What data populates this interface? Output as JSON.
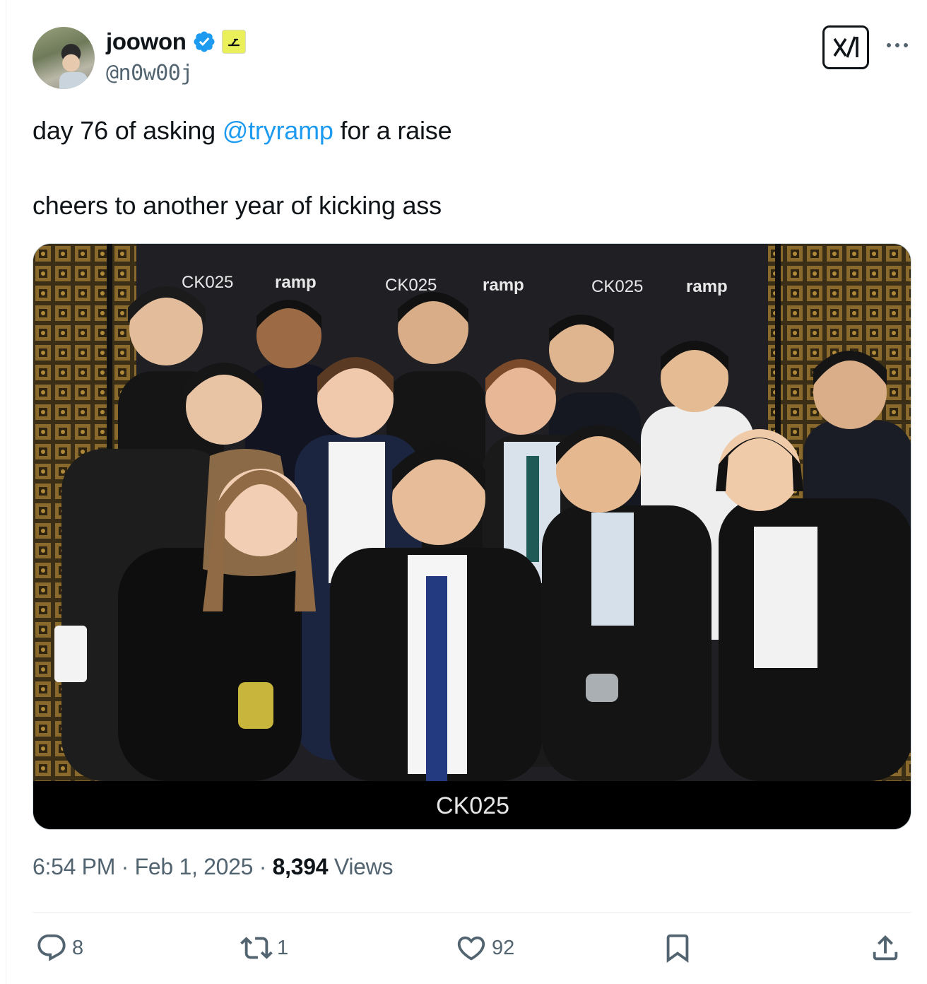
{
  "author": {
    "display_name": "joowon",
    "handle": "@n0w00j",
    "verified_icon": "verified-badge-icon",
    "affiliate_icon": "ramp-affiliate-icon"
  },
  "tweet": {
    "line1_pre": "day 76 of asking ",
    "line1_mention": "@tryramp",
    "line1_post": " for a raise",
    "line2": "cheers to another year of kicking ass"
  },
  "photo": {
    "backdrop_texts": [
      "CK025",
      "ramp",
      "CK025",
      "ramp",
      "CK025",
      "ramp"
    ],
    "caption_bar": "CK025"
  },
  "meta": {
    "time": "6:54 PM",
    "sep1": " · ",
    "date": "Feb 1, 2025",
    "sep2": " · ",
    "views_count": "8,394",
    "views_label": " Views"
  },
  "actions": {
    "replies": "8",
    "reposts": "1",
    "likes": "92"
  },
  "colors": {
    "accent": "#1d9bf0",
    "secondary_text": "#536471",
    "affiliate_bg": "#e9f05a"
  }
}
